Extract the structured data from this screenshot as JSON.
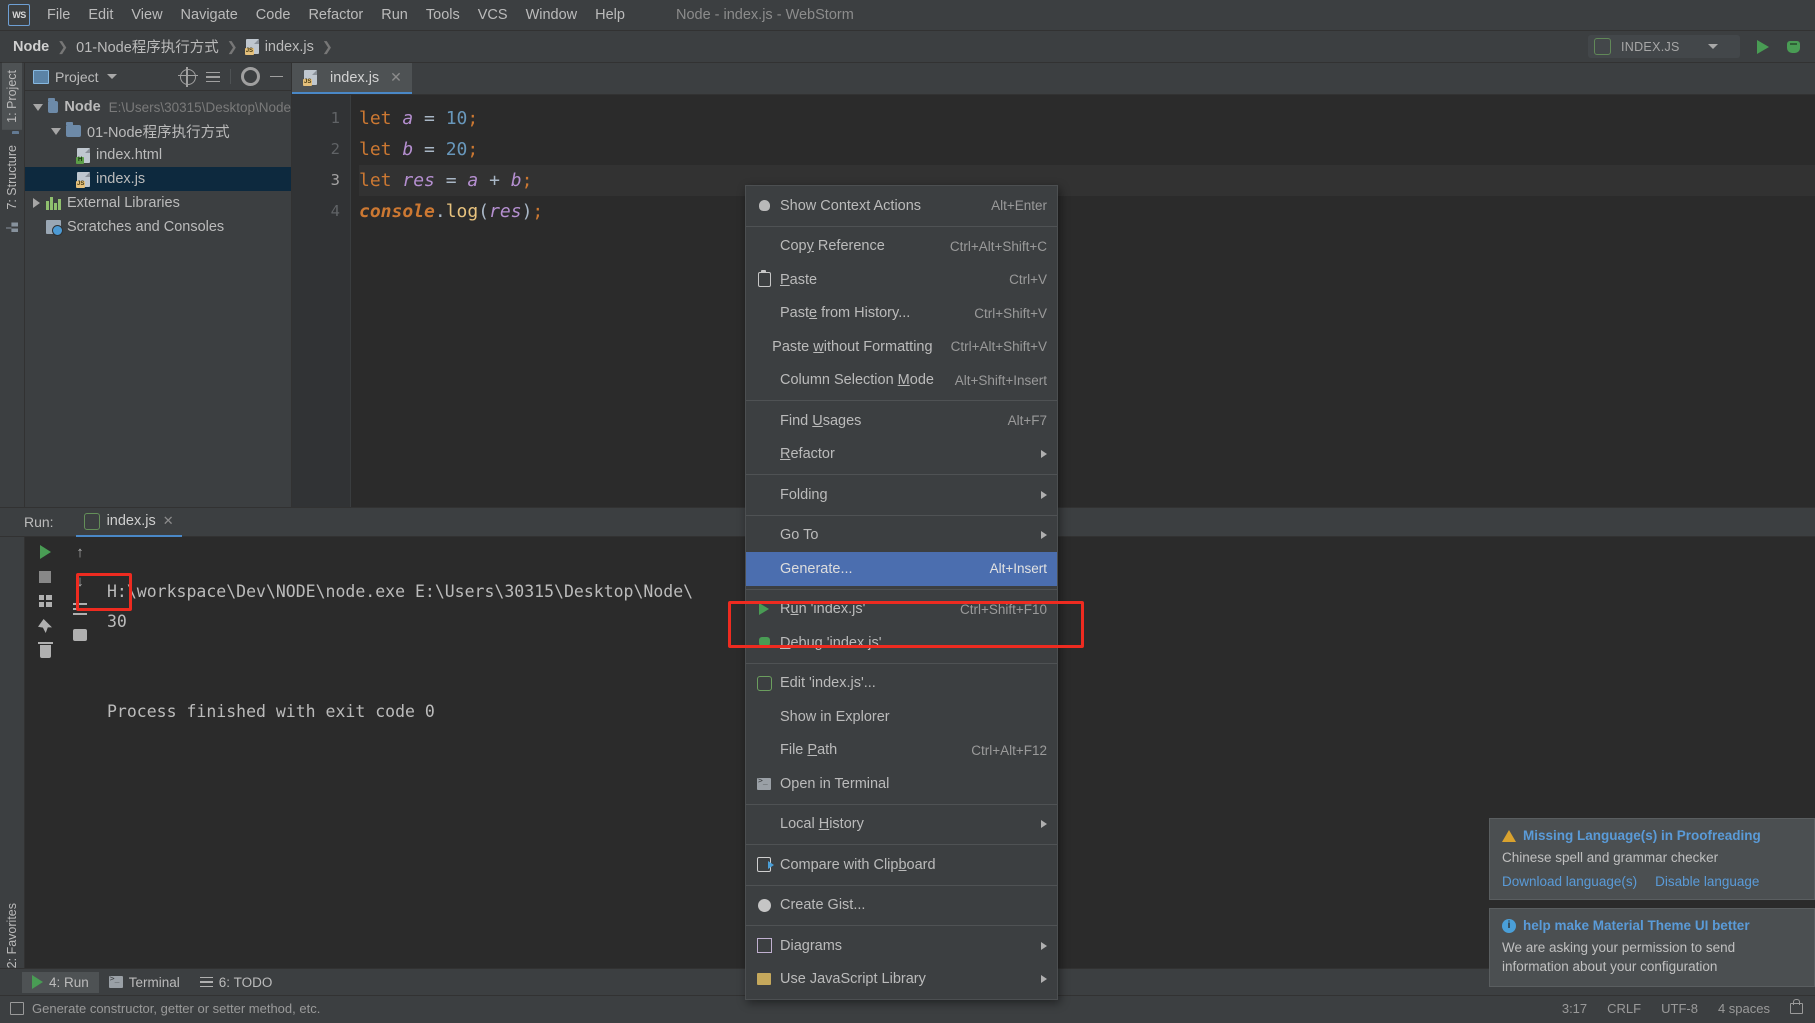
{
  "window": {
    "title": "Node - index.js - WebStorm",
    "logo": "WS"
  },
  "menubar": {
    "items": [
      {
        "label": "File",
        "accel": "F"
      },
      {
        "label": "Edit",
        "accel": "E"
      },
      {
        "label": "View",
        "accel": "V"
      },
      {
        "label": "Navigate",
        "accel": "N"
      },
      {
        "label": "Code",
        "accel": "C"
      },
      {
        "label": "Refactor",
        "accel": "R"
      },
      {
        "label": "Run",
        "accel": "R"
      },
      {
        "label": "Tools",
        "accel": "T"
      },
      {
        "label": "VCS",
        "accel": "V"
      },
      {
        "label": "Window",
        "accel": "W"
      },
      {
        "label": "Help",
        "accel": "H"
      }
    ]
  },
  "breadcrumb": {
    "items": [
      "Node",
      "01-Node程序执行方式",
      "index.js"
    ]
  },
  "run_configuration": {
    "name": "INDEX.JS"
  },
  "left_tool_strip": {
    "tabs": [
      "1: Project",
      "7: Structure"
    ],
    "favorites": "2: Favorites"
  },
  "project_panel": {
    "title": "Project",
    "tree": [
      {
        "label": "Node",
        "detail": "E:\\Users\\30315\\Desktop\\Node",
        "type": "folder",
        "depth": 0,
        "expanded": true,
        "bold": true,
        "selected": false
      },
      {
        "label": "01-Node程序执行方式",
        "detail": "",
        "type": "folder",
        "depth": 1,
        "expanded": true,
        "bold": false,
        "selected": false
      },
      {
        "label": "index.html",
        "detail": "",
        "type": "html",
        "depth": 2,
        "expanded": null,
        "bold": false,
        "selected": false
      },
      {
        "label": "index.js",
        "detail": "",
        "type": "js",
        "depth": 2,
        "expanded": null,
        "bold": false,
        "selected": true
      },
      {
        "label": "External Libraries",
        "detail": "",
        "type": "libraries",
        "depth": 0,
        "expanded": false,
        "bold": false,
        "selected": false
      },
      {
        "label": "Scratches and Consoles",
        "detail": "",
        "type": "scratches",
        "depth": 0,
        "expanded": null,
        "bold": false,
        "selected": false
      }
    ]
  },
  "editor": {
    "tab": {
      "label": "index.js"
    },
    "line_numbers": [
      "1",
      "2",
      "3",
      "4"
    ],
    "current_line": 3,
    "lines": [
      [
        {
          "t": "let ",
          "c": "kw"
        },
        {
          "t": "a",
          "c": "var"
        },
        {
          "t": " = ",
          "c": "ident"
        },
        {
          "t": "10",
          "c": "num"
        },
        {
          "t": ";",
          "c": "pun"
        }
      ],
      [
        {
          "t": "let ",
          "c": "kw"
        },
        {
          "t": "b",
          "c": "var"
        },
        {
          "t": " = ",
          "c": "ident"
        },
        {
          "t": "20",
          "c": "num"
        },
        {
          "t": ";",
          "c": "pun"
        }
      ],
      [
        {
          "t": "let ",
          "c": "kw"
        },
        {
          "t": "res",
          "c": "var"
        },
        {
          "t": " = ",
          "c": "ident"
        },
        {
          "t": "a",
          "c": "var"
        },
        {
          "t": " + ",
          "c": "ident"
        },
        {
          "t": "b",
          "c": "var"
        },
        {
          "t": ";",
          "c": "pun"
        }
      ],
      [
        {
          "t": "console",
          "c": "obj"
        },
        {
          "t": ".",
          "c": "ident"
        },
        {
          "t": "log",
          "c": "fn"
        },
        {
          "t": "(",
          "c": "paren"
        },
        {
          "t": "res",
          "c": "var"
        },
        {
          "t": ")",
          "c": "paren"
        },
        {
          "t": ";",
          "c": "pun"
        }
      ]
    ]
  },
  "context_menu": {
    "items": [
      {
        "label": "Show Context Actions",
        "shortcut": "Alt+Enter",
        "icon": "lightbulb-icon",
        "accel": "",
        "submenu": false,
        "selected": false,
        "sep_after": true
      },
      {
        "label": "Copy Reference",
        "shortcut": "Ctrl+Alt+Shift+C",
        "icon": "",
        "accel": "y",
        "submenu": false,
        "selected": false,
        "sep_after": false
      },
      {
        "label": "Paste",
        "shortcut": "Ctrl+V",
        "icon": "clipboard-icon",
        "accel": "P",
        "submenu": false,
        "selected": false,
        "sep_after": false
      },
      {
        "label": "Paste from History...",
        "shortcut": "Ctrl+Shift+V",
        "icon": "",
        "accel": "e",
        "submenu": false,
        "selected": false,
        "sep_after": false
      },
      {
        "label": "Paste without Formatting",
        "shortcut": "Ctrl+Alt+Shift+V",
        "icon": "",
        "accel": "w",
        "submenu": false,
        "selected": false,
        "sep_after": false
      },
      {
        "label": "Column Selection Mode",
        "shortcut": "Alt+Shift+Insert",
        "icon": "",
        "accel": "M",
        "submenu": false,
        "selected": false,
        "sep_after": true
      },
      {
        "label": "Find Usages",
        "shortcut": "Alt+F7",
        "icon": "",
        "accel": "U",
        "submenu": false,
        "selected": false,
        "sep_after": false
      },
      {
        "label": "Refactor",
        "shortcut": "",
        "icon": "",
        "accel": "R",
        "submenu": true,
        "selected": false,
        "sep_after": true
      },
      {
        "label": "Folding",
        "shortcut": "",
        "icon": "",
        "accel": "",
        "submenu": true,
        "selected": false,
        "sep_after": true
      },
      {
        "label": "Go To",
        "shortcut": "",
        "icon": "",
        "accel": "",
        "submenu": true,
        "selected": false,
        "sep_after": false
      },
      {
        "label": "Generate...",
        "shortcut": "Alt+Insert",
        "icon": "",
        "accel": "",
        "submenu": false,
        "selected": true,
        "sep_after": true
      },
      {
        "label": "Run 'index.js'",
        "shortcut": "Ctrl+Shift+F10",
        "icon": "run-icon",
        "accel": "u",
        "submenu": false,
        "selected": false,
        "sep_after": false,
        "highlighted": true
      },
      {
        "label": "Debug 'index.js'",
        "shortcut": "",
        "icon": "debug-icon",
        "accel": "D",
        "submenu": false,
        "selected": false,
        "sep_after": true
      },
      {
        "label": "Edit 'index.js'...",
        "shortcut": "",
        "icon": "node-icon",
        "accel": "",
        "submenu": false,
        "selected": false,
        "sep_after": false
      },
      {
        "label": "Show in Explorer",
        "shortcut": "",
        "icon": "",
        "accel": "",
        "submenu": false,
        "selected": false,
        "sep_after": false
      },
      {
        "label": "File Path",
        "shortcut": "Ctrl+Alt+F12",
        "icon": "",
        "accel": "P",
        "submenu": false,
        "selected": false,
        "sep_after": false
      },
      {
        "label": "Open in Terminal",
        "shortcut": "",
        "icon": "terminal-icon",
        "accel": "",
        "submenu": false,
        "selected": false,
        "sep_after": true
      },
      {
        "label": "Local History",
        "shortcut": "",
        "icon": "",
        "accel": "H",
        "submenu": true,
        "selected": false,
        "sep_after": true
      },
      {
        "label": "Compare with Clipboard",
        "shortcut": "",
        "icon": "compare-icon",
        "accel": "b",
        "submenu": false,
        "selected": false,
        "sep_after": true
      },
      {
        "label": "Create Gist...",
        "shortcut": "",
        "icon": "github-icon",
        "accel": "",
        "submenu": false,
        "selected": false,
        "sep_after": true
      },
      {
        "label": "Diagrams",
        "shortcut": "",
        "icon": "diagram-icon",
        "accel": "",
        "submenu": true,
        "selected": false,
        "sep_after": false
      },
      {
        "label": "Use JavaScript Library",
        "shortcut": "",
        "icon": "js-library-icon",
        "accel": "",
        "submenu": true,
        "selected": false,
        "sep_after": false
      }
    ]
  },
  "run_panel": {
    "label": "Run:",
    "tab": "index.js",
    "console_lines": [
      "H:\\workspace\\Dev\\NODE\\node.exe E:\\Users\\30315\\Desktop\\Node\\",
      "30",
      "",
      "Process finished with exit code 0"
    ],
    "highlighted_output": "30"
  },
  "notifications": [
    {
      "id": "proofreading",
      "icon": "warning-icon",
      "title": "Missing Language(s) in Proofreading",
      "body": "Chinese spell and grammar checker",
      "actions": [
        "Download language(s)",
        "Disable language"
      ]
    },
    {
      "id": "material-theme",
      "icon": "info-icon",
      "title": "help make Material Theme UI better",
      "body": "We are asking your permission to send information about your configuration",
      "actions": []
    }
  ],
  "bottom_tool_tabs": [
    {
      "label": "4: Run",
      "icon": "run-icon",
      "active": true
    },
    {
      "label": "Terminal",
      "icon": "terminal-icon",
      "active": false
    },
    {
      "label": "6: TODO",
      "icon": "todo-icon",
      "active": false
    }
  ],
  "status_bar": {
    "message": "Generate constructor, getter or setter method, etc.",
    "caret": "3:17",
    "line_sep": "CRLF",
    "encoding": "UTF-8",
    "indent": "4 spaces",
    "lock": "lock-icon"
  }
}
